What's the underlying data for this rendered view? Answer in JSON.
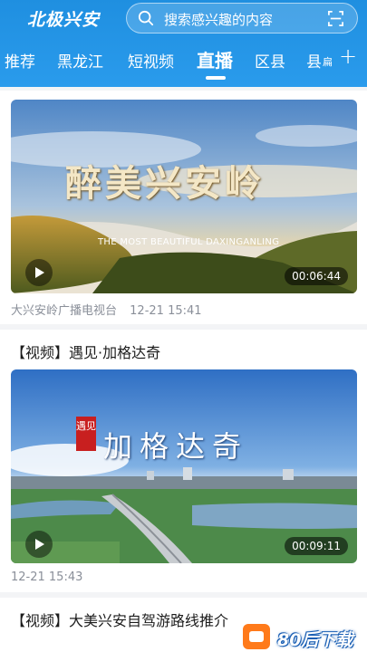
{
  "header": {
    "logo": "北极兴安",
    "search_placeholder": "搜索感兴趣的内容"
  },
  "tabs": [
    {
      "label": "推荐"
    },
    {
      "label": "黑龙江"
    },
    {
      "label": "短视频"
    },
    {
      "label": "直播",
      "active": true
    },
    {
      "label": "区县"
    },
    {
      "label": "县"
    }
  ],
  "tab_more": "​扁",
  "tab_add": "+",
  "feed": {
    "items": [
      {
        "cover_title": "醉美兴安岭",
        "cover_subtitle": "THE MOST BEAUTIFUL DAXINGANLING",
        "duration": "00:06:44",
        "source": "大兴安岭广播电视台",
        "time": "12-21 15:41"
      },
      {
        "title": "【视频】遇见·加格达奇",
        "cover_seal": "遇见",
        "cover_title": "加格达奇",
        "duration": "00:09:11",
        "time": "12-21 15:43"
      },
      {
        "title": "【视频】大美兴安自驾游路线推介"
      }
    ]
  },
  "watermark": "80后下载",
  "colors": {
    "header": "#2a9bec",
    "text_muted": "#8a8f99"
  }
}
